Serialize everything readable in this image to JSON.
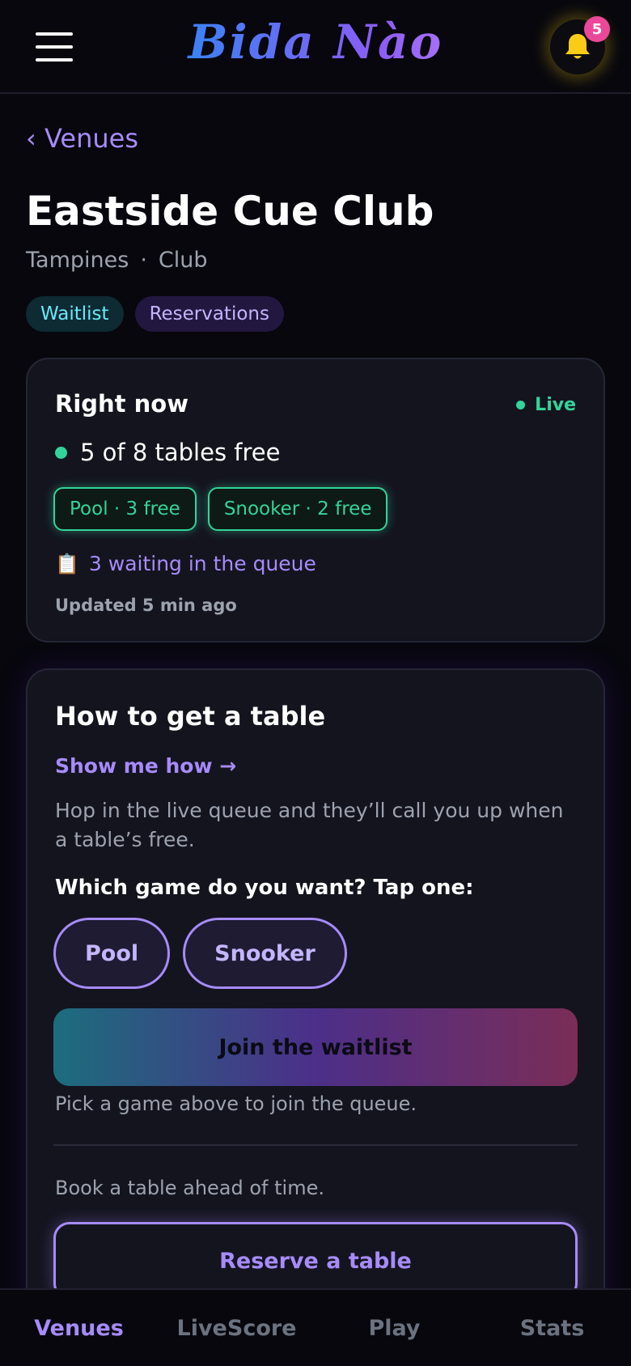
{
  "header": {
    "logo": "Bida Nào",
    "notification_count": "5"
  },
  "breadcrumb": {
    "back_label": "‹ Venues"
  },
  "venue": {
    "name": "Eastside Cue Club",
    "area": "Tampines",
    "separator": "·",
    "type": "Club",
    "tags": [
      "Waitlist",
      "Reservations"
    ]
  },
  "now_card": {
    "title": "Right now",
    "live_label": "Live",
    "tables_free": "5 of 8 tables free",
    "chips": [
      "Pool · 3 free",
      "Snooker · 2 free"
    ],
    "queue_icon": "📋",
    "queue_text": "3 waiting in the queue",
    "updated": "Updated 5 min ago"
  },
  "get_table": {
    "title": "How to get a table",
    "show_how": "Show me how →",
    "description": "Hop in the live queue and they’ll call you up when a table’s free.",
    "game_prompt": "Which game do you want? Tap one:",
    "games": [
      "Pool",
      "Snooker"
    ],
    "join_label": "Join the waitlist",
    "pick_hint": "Pick a game above to join the queue.",
    "book_text": "Book a table ahead of time.",
    "reserve_label": "Reserve a table"
  },
  "bottom_nav": {
    "items": [
      "Venues",
      "LiveScore",
      "Play",
      "Stats"
    ],
    "active": "Venues"
  },
  "colors": {
    "accent": "#a78bfa",
    "live_green": "#34d399",
    "badge_pink": "#ec4899",
    "bell_yellow": "#facc15"
  }
}
